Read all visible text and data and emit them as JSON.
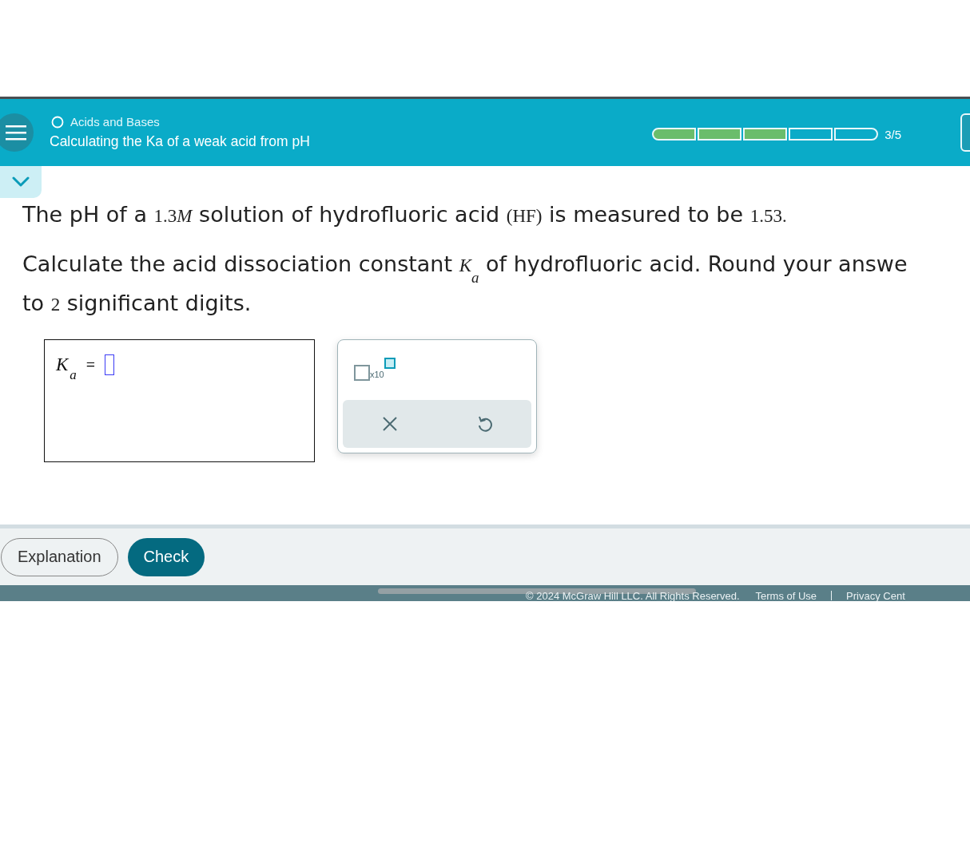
{
  "header": {
    "topic": "Acids and Bases",
    "title": "Calculating the Ka of a weak acid from pH",
    "progress": {
      "segments": [
        {
          "done": true
        },
        {
          "done": true
        },
        {
          "done": true
        },
        {
          "done": false
        },
        {
          "done": false
        }
      ],
      "label": "3/5"
    }
  },
  "question": {
    "lines": [
      [
        {
          "kind": "text",
          "text": "The pH of a "
        },
        {
          "kind": "num",
          "text": "1.3"
        },
        {
          "kind": "var",
          "text": "M"
        },
        {
          "kind": "text",
          "text": " solution of hydrofluoric acid "
        },
        {
          "kind": "num",
          "text": "(HF)"
        },
        {
          "kind": "text",
          "text": " is measured to be "
        },
        {
          "kind": "num",
          "text": "1.53."
        }
      ],
      [
        {
          "kind": "text",
          "text": "Calculate the acid dissociation constant "
        },
        {
          "kind": "var",
          "text": "K"
        },
        {
          "kind": "sub",
          "text": "a"
        },
        {
          "kind": "text",
          "text": " of hydrofluoric acid. Round your answe"
        }
      ],
      [
        {
          "kind": "text",
          "text": "to "
        },
        {
          "kind": "num",
          "text": "2"
        },
        {
          "kind": "text",
          "text": " significant digits."
        }
      ]
    ]
  },
  "answer": {
    "symbol": "K",
    "subscript": "a",
    "equals": "="
  },
  "palette": {
    "exponent_label": "x10"
  },
  "actions": [
    {
      "label": "Explanation",
      "kind": "secondary"
    },
    {
      "label": "Check",
      "kind": "primary"
    }
  ],
  "footer": {
    "copyright": "© 2024 McGraw Hill LLC. All Rights Reserved.",
    "links": [
      "Terms of Use",
      "Privacy Cent"
    ]
  }
}
